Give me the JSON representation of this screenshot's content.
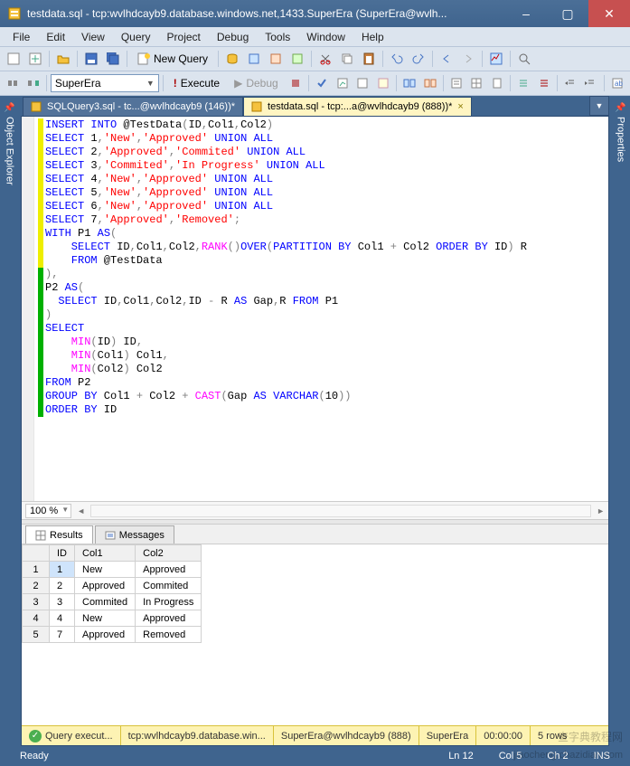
{
  "window": {
    "title": "testdata.sql - tcp:wvlhdcayb9.database.windows.net,1433.SuperEra (SuperEra@wvlh...",
    "min": "–",
    "max": "▢",
    "close": "✕"
  },
  "menu": [
    "File",
    "Edit",
    "View",
    "Query",
    "Project",
    "Debug",
    "Tools",
    "Window",
    "Help"
  ],
  "toolbar1": {
    "new_query": "New Query"
  },
  "toolbar2": {
    "database": "SuperEra",
    "execute": "Execute",
    "debug": "Debug"
  },
  "side_left": "Object Explorer",
  "side_right": "Properties",
  "tabs": [
    {
      "label": "SQLQuery3.sql - tc...@wvlhdcayb9 (146))*",
      "active": false
    },
    {
      "label": "testdata.sql - tcp:...a@wvlhdcayb9 (888))*",
      "active": true
    }
  ],
  "zoom": "100 %",
  "results_tabs": {
    "results": "Results",
    "messages": "Messages"
  },
  "grid": {
    "cols": [
      "",
      "ID",
      "Col1",
      "Col2"
    ],
    "rows": [
      [
        "1",
        "1",
        "New",
        "Approved"
      ],
      [
        "2",
        "2",
        "Approved",
        "Commited"
      ],
      [
        "3",
        "3",
        "Commited",
        "In Progress"
      ],
      [
        "4",
        "4",
        "New",
        "Approved"
      ],
      [
        "5",
        "7",
        "Approved",
        "Removed"
      ]
    ]
  },
  "status_yellow": {
    "exec": "Query execut...",
    "server": "tcp:wvlhdcayb9.database.win...",
    "user": "SuperEra@wvlhdcayb9 (888)",
    "db": "SuperEra",
    "time": "00:00:00",
    "rows": "5 rows"
  },
  "statusbar": {
    "ready": "Ready",
    "ln": "Ln 12",
    "col": "Col 5",
    "ch": "Ch 2",
    "ins": "INS"
  },
  "watermark1": "查字典教程网",
  "watermark2": "jiaocheng.chazidian.com",
  "code": {
    "l1a": "INSERT INTO",
    "l1b": " @TestData",
    "l1c": "(",
    "l1d": "ID",
    "l1e": ",",
    "l1f": "Col1",
    "l1g": ",",
    "l1h": "Col2",
    "l1i": ")",
    "l2a": "SELECT ",
    "l2b": "1",
    "l2c": ",",
    "l2d": "'New'",
    "l2e": ",",
    "l2f": "'Approved'",
    "l2g": " UNION ALL",
    "l3a": "SELECT ",
    "l3b": "2",
    "l3c": ",",
    "l3d": "'Approved'",
    "l3e": ",",
    "l3f": "'Commited'",
    "l3g": " UNION ALL",
    "l4a": "SELECT ",
    "l4b": "3",
    "l4c": ",",
    "l4d": "'Commited'",
    "l4e": ",",
    "l4f": "'In Progress'",
    "l4g": " UNION ALL",
    "l5a": "SELECT ",
    "l5b": "4",
    "l5c": ",",
    "l5d": "'New'",
    "l5e": ",",
    "l5f": "'Approved'",
    "l5g": " UNION ALL",
    "l6a": "SELECT ",
    "l6b": "5",
    "l6c": ",",
    "l6d": "'New'",
    "l6e": ",",
    "l6f": "'Approved'",
    "l6g": " UNION ALL",
    "l7a": "SELECT ",
    "l7b": "6",
    "l7c": ",",
    "l7d": "'New'",
    "l7e": ",",
    "l7f": "'Approved'",
    "l7g": " UNION ALL",
    "l8a": "SELECT ",
    "l8b": "7",
    "l8c": ",",
    "l8d": "'Approved'",
    "l8e": ",",
    "l8f": "'Removed'",
    "l8g": ";",
    "l9a": "WITH",
    "l9b": " P1 ",
    "l9c": "AS",
    "l9d": "(",
    "l10a": "    SELECT",
    "l10b": " ID",
    "l10c": ",",
    "l10d": "Col1",
    "l10e": ",",
    "l10f": "Col2",
    "l10g": ",",
    "l10h": "RANK",
    "l10i": "()",
    "l10j": "OVER",
    "l10k": "(",
    "l10l": "PARTITION BY",
    "l10m": " Col1 ",
    "l10n": "+",
    "l10o": " Col2 ",
    "l10p": "ORDER BY",
    "l10q": " ID",
    "l10r": ")",
    "l10s": " R",
    "l11a": "    FROM",
    "l11b": " @TestData",
    "l12a": ")",
    "l12b": ",",
    "l13a": "P2 ",
    "l13b": "AS",
    "l13c": "(",
    "l14a": "  SELECT",
    "l14b": " ID",
    "l14c": ",",
    "l14d": "Col1",
    "l14e": ",",
    "l14f": "Col2",
    "l14g": ",",
    "l14h": "ID ",
    "l14i": "-",
    "l14j": " R ",
    "l14k": "AS",
    "l14l": " Gap",
    "l14m": ",",
    "l14n": "R ",
    "l14o": "FROM",
    "l14p": " P1",
    "l15a": ")",
    "l16a": "SELECT",
    "l17a": "    MIN",
    "l17b": "(",
    "l17c": "ID",
    "l17d": ")",
    "l17e": " ID",
    "l17f": ",",
    "l18a": "    MIN",
    "l18b": "(",
    "l18c": "Col1",
    "l18d": ")",
    "l18e": " Col1",
    "l18f": ",",
    "l19a": "    MIN",
    "l19b": "(",
    "l19c": "Col2",
    "l19d": ")",
    "l19e": " Col2",
    "l20a": "FROM",
    "l20b": " P2",
    "l21a": "GROUP BY",
    "l21b": " Col1 ",
    "l21c": "+",
    "l21d": " Col2 ",
    "l21e": "+",
    "l21f": " CAST",
    "l21g": "(",
    "l21h": "Gap ",
    "l21i": "AS",
    "l21j": " VARCHAR",
    "l21k": "(",
    "l21l": "10",
    "l21m": "))",
    "l22a": "ORDER BY",
    "l22b": " ID"
  }
}
